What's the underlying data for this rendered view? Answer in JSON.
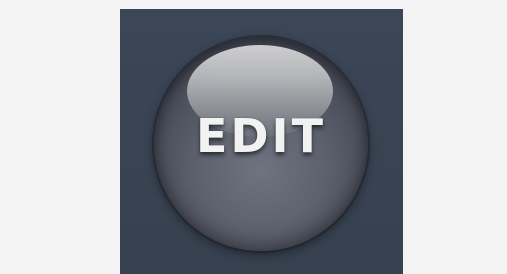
{
  "button": {
    "label": "EDIT"
  },
  "colors": {
    "background": "#f3f3f3",
    "panel": "#3a4453",
    "button_base": "#5d616d",
    "gloss": "#b9babd",
    "label": "#f2f2f2"
  }
}
